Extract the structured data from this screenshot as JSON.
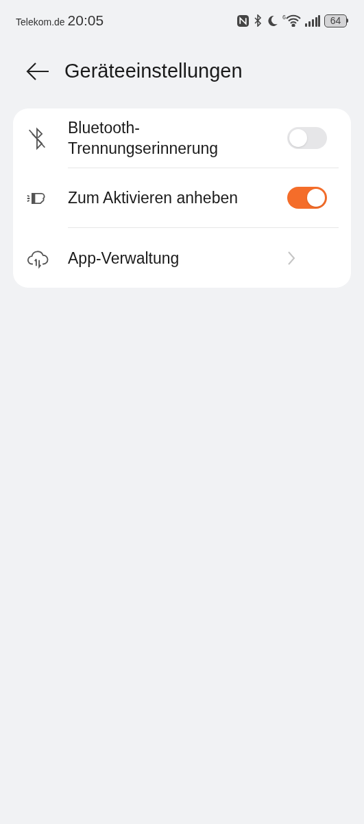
{
  "status_bar": {
    "carrier": "Telekom.de",
    "time": "20:05",
    "wifi_badge": "6",
    "battery": "64"
  },
  "header": {
    "title": "Geräteeinstellungen"
  },
  "items": [
    {
      "kind": "toggle",
      "label": "Bluetooth-Trennungserinnerung",
      "on": false
    },
    {
      "kind": "toggle",
      "label": "Zum Aktivieren anheben",
      "on": true
    },
    {
      "kind": "link",
      "label": "App-Verwaltung"
    }
  ]
}
